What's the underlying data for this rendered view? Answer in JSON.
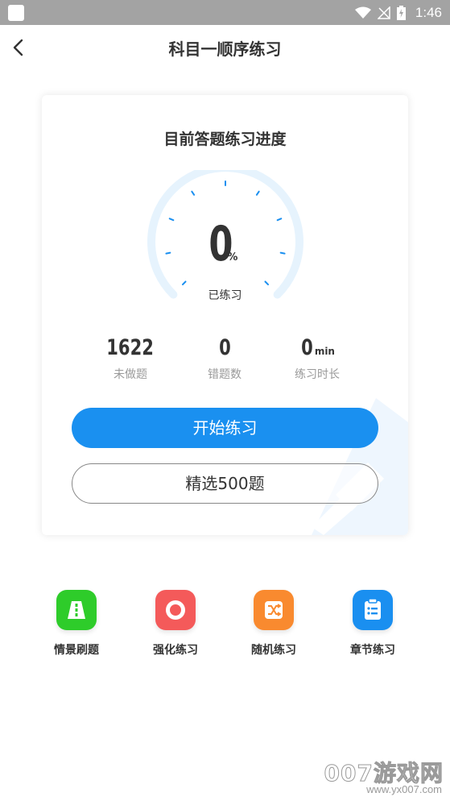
{
  "status_bar": {
    "time": "1:46"
  },
  "nav": {
    "title": "科目一顺序练习"
  },
  "progress_card": {
    "title": "目前答题练习进度",
    "percent_value": "0",
    "percent_unit": "%",
    "percent_label": "已练习",
    "stats": [
      {
        "value": "1622",
        "unit": "",
        "label": "未做题"
      },
      {
        "value": "0",
        "unit": "",
        "label": "错题数"
      },
      {
        "value": "0",
        "unit": "min",
        "label": "练习时长"
      }
    ],
    "start_button": "开始练习",
    "select_button": "精选500题"
  },
  "features": [
    {
      "label": "情景刷题",
      "icon": "road-icon",
      "color": "#2ecc2a"
    },
    {
      "label": "强化练习",
      "icon": "target-icon",
      "color": "#f45a5a"
    },
    {
      "label": "随机练习",
      "icon": "shuffle-icon",
      "color": "#f98a2f"
    },
    {
      "label": "章节练习",
      "icon": "clipboard-list-icon",
      "color": "#1a8ff0"
    }
  ],
  "watermark": {
    "brand": "007游戏网",
    "url": "www.yx007.com"
  },
  "colors": {
    "accent": "#1a90f0",
    "gauge_track": "#e6f3fd",
    "gauge_tick": "#1a8ff0"
  }
}
